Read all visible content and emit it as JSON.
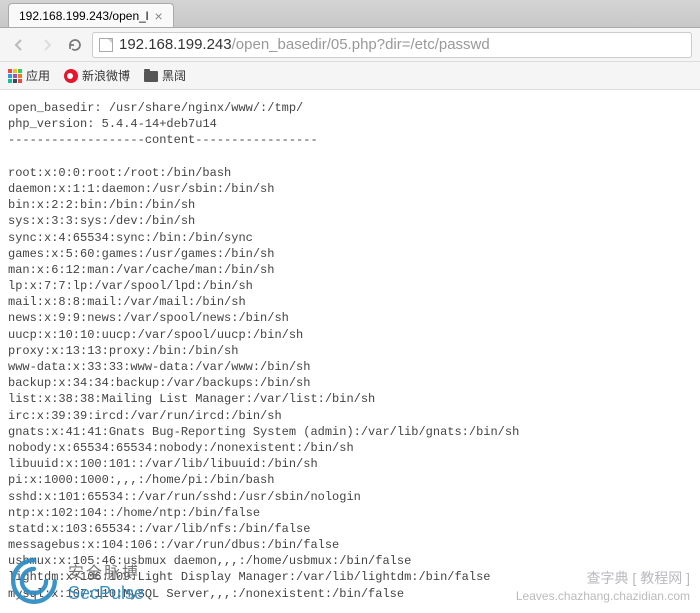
{
  "tab": {
    "title": "192.168.199.243/open_l"
  },
  "url": {
    "host": "192.168.199.243",
    "path": "/open_basedir/05.php?dir=/etc/passwd"
  },
  "bookmarks": {
    "apps_label": "应用",
    "items": [
      {
        "label": "新浪微博"
      },
      {
        "label": "黑阔"
      }
    ]
  },
  "page": {
    "open_basedir_label": "open_basedir:",
    "open_basedir_value": "/usr/share/nginx/www/:/tmp/",
    "php_version_label": "php_version:",
    "php_version_value": "5.4.4-14+deb7u14",
    "divider": "-------------------content-----------------",
    "passwd_lines": [
      "root:x:0:0:root:/root:/bin/bash",
      "daemon:x:1:1:daemon:/usr/sbin:/bin/sh",
      "bin:x:2:2:bin:/bin:/bin/sh",
      "sys:x:3:3:sys:/dev:/bin/sh",
      "sync:x:4:65534:sync:/bin:/bin/sync",
      "games:x:5:60:games:/usr/games:/bin/sh",
      "man:x:6:12:man:/var/cache/man:/bin/sh",
      "lp:x:7:7:lp:/var/spool/lpd:/bin/sh",
      "mail:x:8:8:mail:/var/mail:/bin/sh",
      "news:x:9:9:news:/var/spool/news:/bin/sh",
      "uucp:x:10:10:uucp:/var/spool/uucp:/bin/sh",
      "proxy:x:13:13:proxy:/bin:/bin/sh",
      "www-data:x:33:33:www-data:/var/www:/bin/sh",
      "backup:x:34:34:backup:/var/backups:/bin/sh",
      "list:x:38:38:Mailing List Manager:/var/list:/bin/sh",
      "irc:x:39:39:ircd:/var/run/ircd:/bin/sh",
      "gnats:x:41:41:Gnats Bug-Reporting System (admin):/var/lib/gnats:/bin/sh",
      "nobody:x:65534:65534:nobody:/nonexistent:/bin/sh",
      "libuuid:x:100:101::/var/lib/libuuid:/bin/sh",
      "pi:x:1000:1000:,,,:/home/pi:/bin/bash",
      "sshd:x:101:65534::/var/run/sshd:/usr/sbin/nologin",
      "ntp:x:102:104::/home/ntp:/bin/false",
      "statd:x:103:65534::/var/lib/nfs:/bin/false",
      "messagebus:x:104:106::/var/run/dbus:/bin/false",
      "usbmux:x:105:46:usbmux daemon,,,:/home/usbmux:/bin/false",
      "lightdm:x:106:109:Light Display Manager:/var/lib/lightdm:/bin/false",
      "mysql:x:107:110:MySQL Server,,,:/nonexistent:/bin/false"
    ]
  },
  "watermark_left": {
    "cn": "安全脉搏",
    "en": "SecPulse"
  },
  "watermark_right": {
    "line1": "查字典 [ 教程网 ]",
    "line2": "Leaves.chazhang.chazidian.com"
  }
}
